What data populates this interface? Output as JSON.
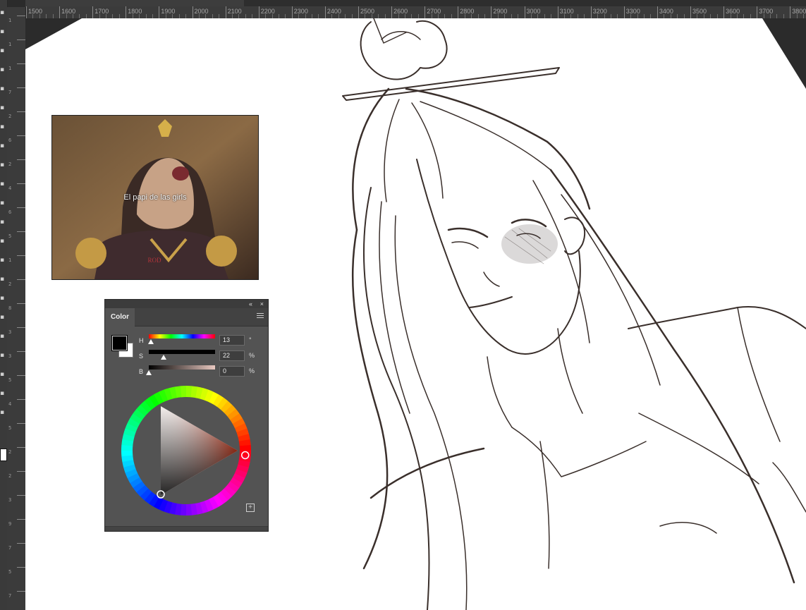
{
  "ruler": {
    "horizontal_labels": [
      "1500",
      "1600",
      "1700",
      "1800",
      "1900",
      "2000",
      "2100",
      "2200",
      "2300",
      "2400",
      "2500",
      "2600",
      "2700",
      "2800",
      "2900",
      "3000",
      "3100",
      "3200",
      "3300",
      "3400",
      "3500",
      "3600",
      "3700",
      "3800"
    ],
    "vertical_labels": [
      "1",
      "1",
      "1",
      "7",
      "2",
      "6",
      "2",
      "4",
      "6",
      "5",
      "1",
      "2",
      "8",
      "3",
      "3",
      "5",
      "4",
      "5",
      "2",
      "2",
      "3",
      "9",
      "7",
      "5",
      "7"
    ]
  },
  "reference": {
    "caption": "El papi de las girls",
    "emblem": "ROD"
  },
  "color_panel": {
    "tab_label": "Color",
    "collapse_icon": "«",
    "close_icon": "×",
    "foreground_color": "#000000",
    "background_color": "#ffffff",
    "hue": {
      "label": "H",
      "value": "13",
      "unit": "°"
    },
    "saturation": {
      "label": "S",
      "value": "22",
      "unit": "%"
    },
    "brightness": {
      "label": "B",
      "value": "0",
      "unit": "%"
    },
    "wheel_hue_deg": 13,
    "add_icon": "+"
  },
  "colors": {
    "ui_dark": "#535353",
    "canvas_white": "#ffffff",
    "line_art": "#3a2f2b"
  }
}
